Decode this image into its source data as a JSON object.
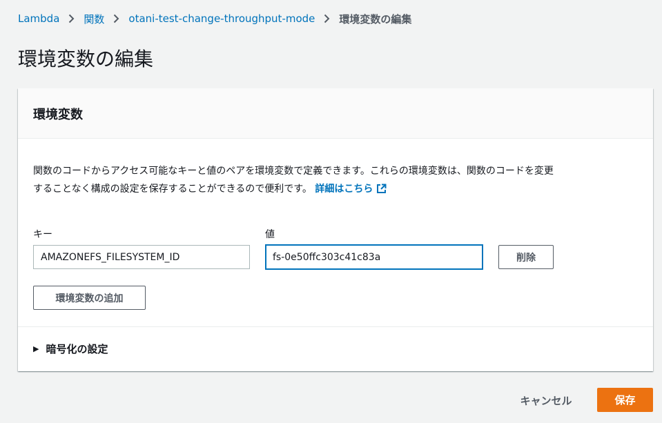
{
  "breadcrumb": {
    "items": [
      "Lambda",
      "関数",
      "otani-test-change-throughput-mode"
    ],
    "current": "環境変数の編集"
  },
  "page": {
    "title": "環境変数の編集"
  },
  "panel": {
    "header": "環境変数",
    "description_line1": "関数のコードからアクセス可能なキーと値のペアを環境変数で定義できます。これらの環境変数は、関数のコードを変更",
    "description_line2": "することなく構成の設定を保存することができるので便利です。",
    "learn_more": "詳細はこちら",
    "key_label": "キー",
    "value_label": "値",
    "key_value": "AMAZONEFS_FILESYSTEM_ID",
    "value_value": "fs-0e50ffc303c41c83a",
    "remove_button": "削除",
    "add_button": "環境変数の追加",
    "encryption_section": "暗号化の設定"
  },
  "footer": {
    "cancel": "キャンセル",
    "save": "保存"
  },
  "colors": {
    "link": "#0073bb",
    "primary_button": "#ec7211",
    "background": "#f2f3f3"
  },
  "icons": {
    "breadcrumb_separator": "chevron-right-icon",
    "external_link": "external-link-icon",
    "expand": "caret-right-icon"
  }
}
